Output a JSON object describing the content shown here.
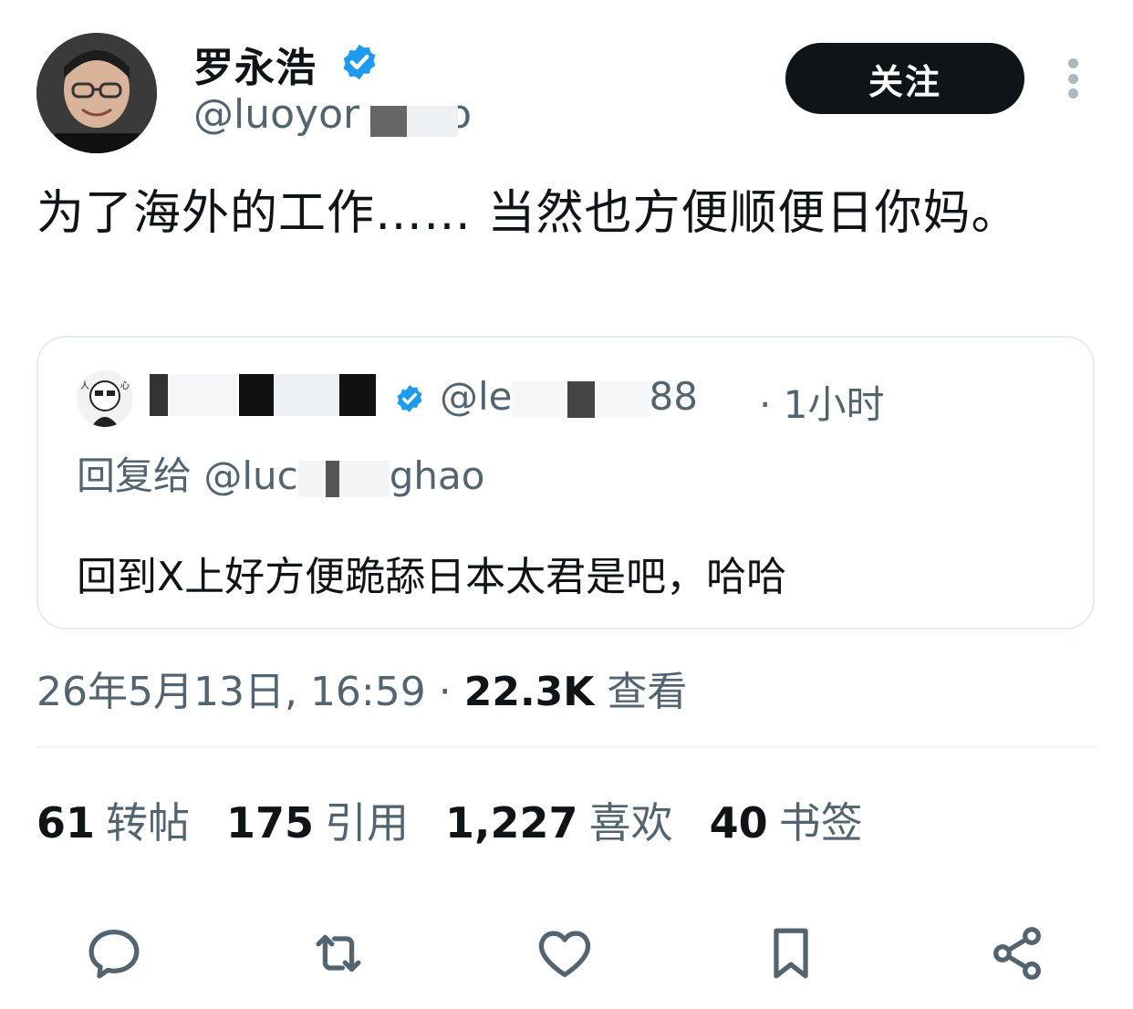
{
  "author": {
    "display_name": "罗永浩",
    "handle_visible": "@luoyor",
    "handle_tail": "o"
  },
  "follow_label": "关注",
  "tweet_text": "为了海外的工作…… 当然也方便顺便日你妈。",
  "quote": {
    "handle_start": "@le",
    "handle_end": "88",
    "time_ago": "1小时",
    "reply_prefix": "回复给",
    "reply_handle_start": "@luc",
    "reply_handle_end": "ghao",
    "text": "回到X上好方便跪舔日本太君是吧，哈哈"
  },
  "timestamp": "26年5月13日, 16:59",
  "views_count": "22.3K",
  "views_label": "查看",
  "stats": [
    {
      "count": "61",
      "label": "转帖"
    },
    {
      "count": "175",
      "label": "引用"
    },
    {
      "count": "1,227",
      "label": "喜欢"
    },
    {
      "count": "40",
      "label": "书签"
    }
  ],
  "icons": {
    "verified": "verified-badge-icon",
    "reply": "reply-icon",
    "retweet": "retweet-icon",
    "like": "heart-icon",
    "bookmark": "bookmark-icon",
    "share": "share-icon",
    "more": "more-vertical-icon"
  },
  "colors": {
    "verified_blue": "#1d9bf0",
    "text_primary": "#0f1419",
    "text_secondary": "#536471",
    "button_bg": "#0f1419"
  }
}
